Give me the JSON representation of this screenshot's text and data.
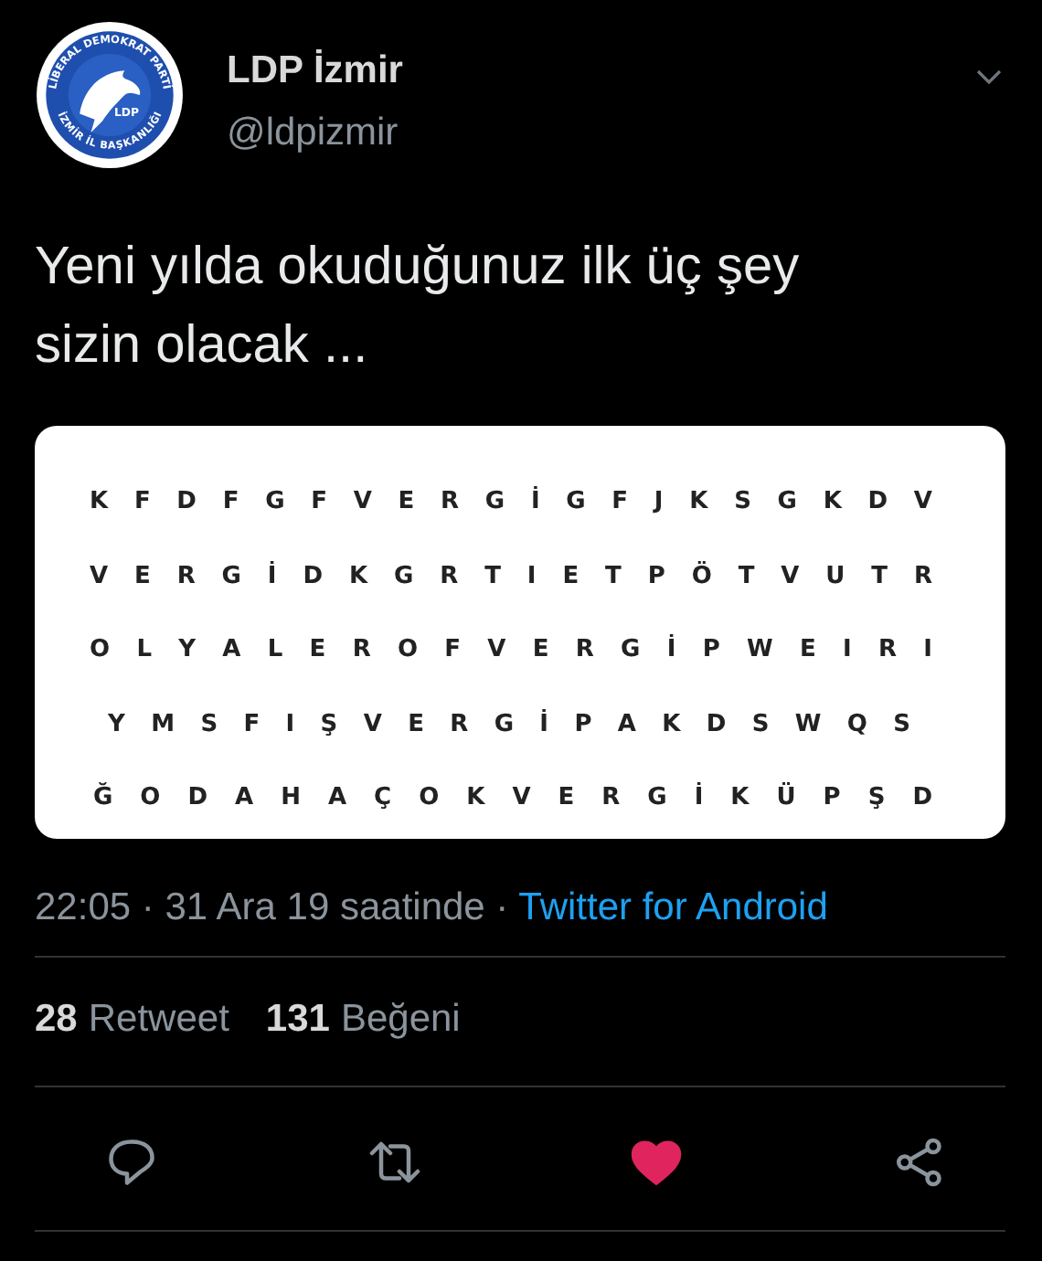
{
  "avatar": {
    "arc_top": "LİBERAL DEMOKRAT PARTİ",
    "arc_bottom": "İZMİR İL BAŞKANLIĞI",
    "badge": "LDP"
  },
  "author": {
    "name": "LDP İzmir",
    "handle": "@ldpizmir"
  },
  "text": "Yeni yılda okuduğunuz ilk üç şey sizin olacak ...",
  "word_search": {
    "rows": [
      "K F D F G F V E R G İ G F J K S G K D V",
      "V E R G İ D K G R T I E T P Ö T V U T R",
      "O L Y A L E R O F V E R G İ P W E I R I",
      "Y M S F I Ş V E R G İ P A K D S W Q S",
      "Ğ O D A H A Ç O K V E R G İ K Ü P Ş D"
    ]
  },
  "meta": {
    "time": "22:05 · 31 Ara 19 saatinde ·",
    "source": "Twitter for Android"
  },
  "stats": [
    {
      "count": "28",
      "label": "Retweet"
    },
    {
      "count": "131",
      "label": "Beğeni"
    }
  ],
  "actions": [
    {
      "kind": "reply"
    },
    {
      "kind": "retweet"
    },
    {
      "kind": "like",
      "liked": true
    },
    {
      "kind": "share"
    }
  ]
}
